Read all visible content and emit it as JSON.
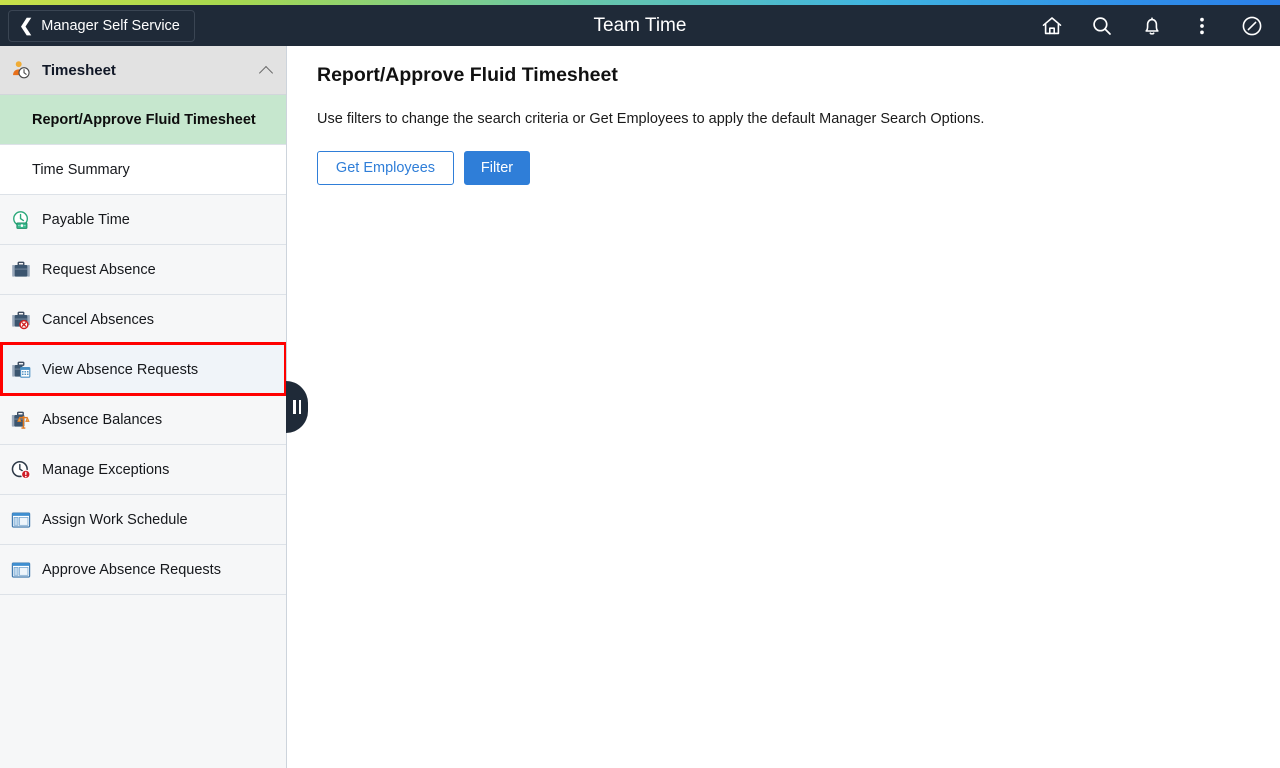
{
  "header": {
    "back_label": "Manager Self Service",
    "back_icon": "chevron-left-icon",
    "title": "Team Time",
    "icons": [
      {
        "name": "home-icon",
        "label": "Home"
      },
      {
        "name": "search-icon",
        "label": "Search"
      },
      {
        "name": "notification-bell-icon",
        "label": "Notifications"
      },
      {
        "name": "actions-menu-icon",
        "label": "Actions"
      },
      {
        "name": "navigator-compass-icon",
        "label": "Navigator"
      }
    ],
    "background_color": "#1f2a38",
    "accent_strip_colors": [
      "#c8e04a",
      "#6fc9a0",
      "#40b5e0",
      "#2a7fe8"
    ]
  },
  "sidebar": {
    "group": {
      "label": "Timesheet",
      "icon": "person-clock-icon",
      "expanded": true,
      "collapse_icon": "chevron-up-icon",
      "background_color": "#e2e2e2"
    },
    "children": [
      {
        "label": "Report/Approve Fluid Timesheet",
        "selected": true,
        "background_color": "#c6e7ce"
      },
      {
        "label": "Time Summary",
        "selected": false,
        "background_color": "#ffffff"
      }
    ],
    "items": [
      {
        "label": "Payable Time",
        "icon": "green-clock-payable-icon",
        "highlighted": false
      },
      {
        "label": "Request Absence",
        "icon": "briefcase-icon",
        "highlighted": false
      },
      {
        "label": "Cancel Absences",
        "icon": "briefcase-cancel-icon",
        "highlighted": false
      },
      {
        "label": "View Absence Requests",
        "icon": "briefcase-calendar-icon",
        "highlighted": true
      },
      {
        "label": "Absence Balances",
        "icon": "briefcase-balance-icon",
        "highlighted": false
      },
      {
        "label": "Manage Exceptions",
        "icon": "clock-alert-icon",
        "highlighted": false
      },
      {
        "label": "Assign Work Schedule",
        "icon": "window-layout-icon",
        "highlighted": false
      },
      {
        "label": "Approve Absence Requests",
        "icon": "window-layout-icon",
        "highlighted": false
      }
    ],
    "highlight_box_color": "#ff0000",
    "collapse_handle": {
      "name": "sidebar-collapse-handle",
      "icon": "pause-bars-icon"
    }
  },
  "main": {
    "page_title": "Report/Approve Fluid Timesheet",
    "instruction": "Use filters to change the search criteria or Get Employees to apply the default Manager Search Options.",
    "buttons": [
      {
        "label": "Get Employees",
        "style": "secondary"
      },
      {
        "label": "Filter",
        "style": "primary"
      }
    ]
  }
}
